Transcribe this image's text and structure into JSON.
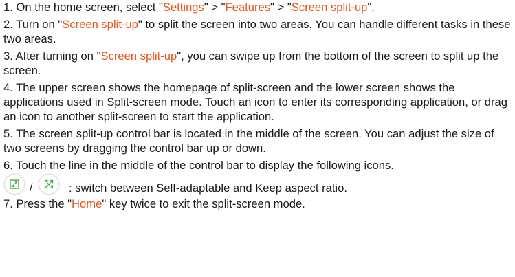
{
  "accent_color": "#e8541a",
  "steps": {
    "s1": {
      "a": "1. On the home screen, select \"",
      "b": "Settings",
      "c": "\" > \"",
      "d": "Features",
      "e": "\" > \"",
      "f": "Screen split-up",
      "g": "\"."
    },
    "s2": {
      "a": "2. Turn on \"",
      "b": "Screen split-up",
      "c": "\" to split the screen into two areas. You can handle different tasks in these two areas."
    },
    "s3": {
      "a": "3. After turning on \"",
      "b": "Screen split-up",
      "c": "\", you can swipe up from the bottom of the screen to split up the screen."
    },
    "s4": {
      "text": "4. The upper screen shows the homepage of split-screen and the lower screen shows the applications used in Split-screen mode. Touch an icon to enter its corresponding application, or drag an icon to another split-screen to start the application."
    },
    "s5": {
      "text": "5. The screen split-up control bar is located in the middle of the screen. You can adjust the size of two screens by dragging the control bar up or down."
    },
    "s6": {
      "text": "6. Touch the line in the middle of the control bar to display the following icons."
    },
    "icons_row": {
      "separator": "/",
      "description": ": switch between Self-adaptable and Keep aspect ratio.",
      "icon_1": "self-adaptable-icon",
      "icon_2": "keep-aspect-ratio-icon"
    },
    "s7": {
      "a": "7. Press the \"",
      "b": "Home",
      "c": "\" key twice to exit the split-screen mode."
    }
  }
}
